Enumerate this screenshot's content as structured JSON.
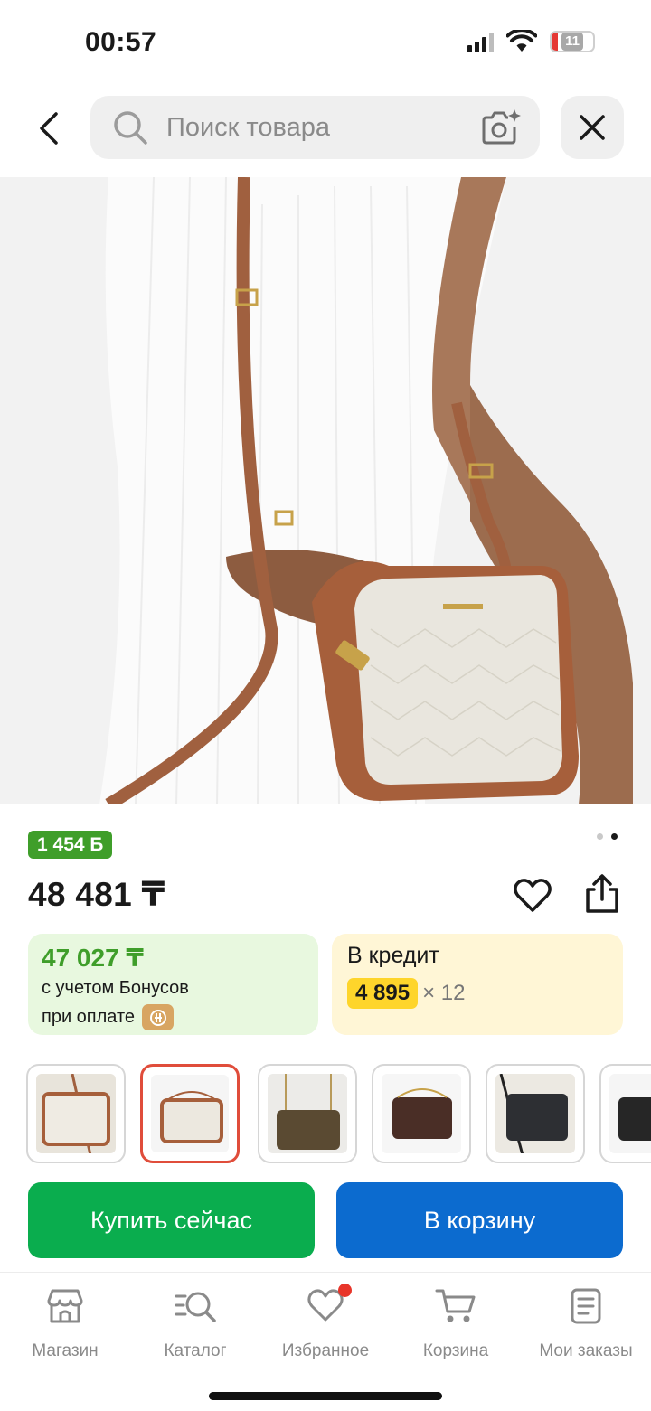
{
  "status_bar": {
    "time": "00:57",
    "battery": "11"
  },
  "search": {
    "placeholder": "Поиск товара",
    "value": ""
  },
  "product": {
    "bonus_badge": "1 454 Ƃ",
    "price": "48 481 ₸",
    "gallery_dots": 2,
    "gallery_active_index": 1
  },
  "bonus_card": {
    "amount": "47 027 ₸",
    "line1": "с учетом Бонусов",
    "line2": "при оплате"
  },
  "credit_card": {
    "title": "В кредит",
    "monthly": "4 895",
    "months": "× 12"
  },
  "variants": {
    "count": 6,
    "selected_index": 1,
    "items": [
      {
        "color": "cream-monogram"
      },
      {
        "color": "cream-brown-trim"
      },
      {
        "color": "brown-monogram"
      },
      {
        "color": "dark-brown"
      },
      {
        "color": "black-monogram"
      },
      {
        "color": "black"
      }
    ]
  },
  "actions": {
    "buy_now": "Купить сейчас",
    "add_to_cart": "В корзину"
  },
  "tabs": [
    {
      "label": "Магазин",
      "icon": "store-icon"
    },
    {
      "label": "Каталог",
      "icon": "catalog-search-icon"
    },
    {
      "label": "Избранное",
      "icon": "heart-icon",
      "has_badge": true
    },
    {
      "label": "Корзина",
      "icon": "cart-icon"
    },
    {
      "label": "Мои заказы",
      "icon": "orders-icon"
    }
  ],
  "colors": {
    "bonus_green": "#3f9e2a",
    "buy_green": "#0aad4e",
    "cart_blue": "#0c6bcf",
    "credit_yellow": "#fed52b",
    "selected_border": "#e04d3b",
    "badge_red": "#e8352a"
  }
}
